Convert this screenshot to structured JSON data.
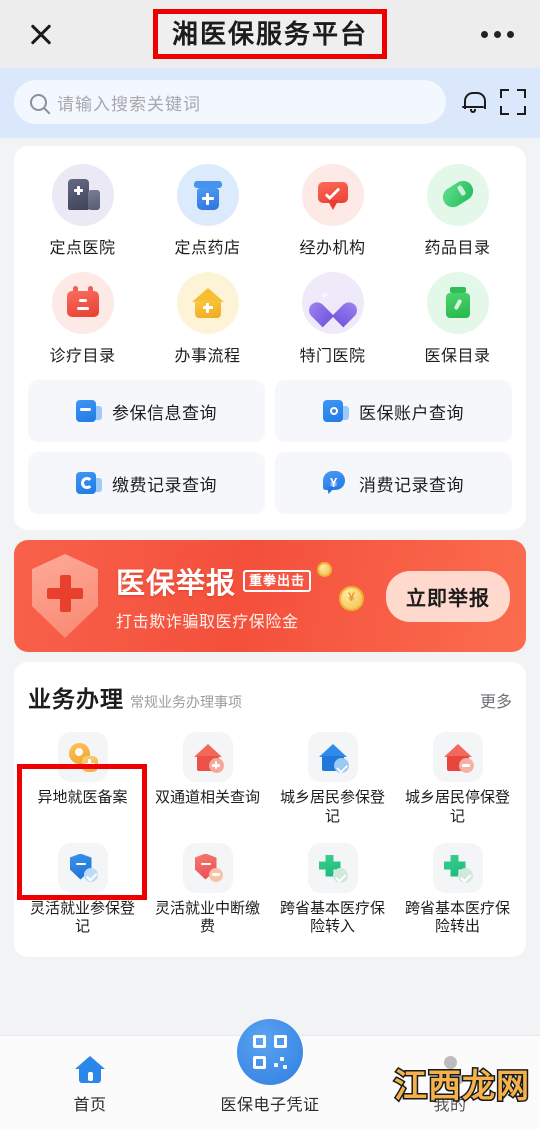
{
  "header": {
    "close_icon": "close-icon",
    "title": "湘医保服务平台",
    "more_icon": "more-dots-icon",
    "highlight_color": "#ef0000"
  },
  "search": {
    "icon": "search-icon",
    "placeholder": "请输入搜索关键词",
    "value": "",
    "bell_icon": "bell-icon",
    "scan_icon": "scan-icon"
  },
  "quick_icons": [
    {
      "label": "定点医院",
      "icon": "hospital-icon",
      "bg": "#ece9f7"
    },
    {
      "label": "定点药店",
      "icon": "pharmacy-icon",
      "bg": "#dcebfc"
    },
    {
      "label": "经办机构",
      "icon": "agency-badge-icon",
      "bg": "#fdeae7"
    },
    {
      "label": "药品目录",
      "icon": "capsule-icon",
      "bg": "#e4f8ea"
    },
    {
      "label": "诊疗目录",
      "icon": "treatment-calendar-icon",
      "bg": "#fdeae7"
    },
    {
      "label": "办事流程",
      "icon": "process-house-icon",
      "bg": "#fdf4d8"
    },
    {
      "label": "特门医院",
      "icon": "heart-icon",
      "bg": "#eeeafa"
    },
    {
      "label": "医保目录",
      "icon": "medicine-bottle-icon",
      "bg": "#e4f8ea"
    }
  ],
  "query_buttons": [
    {
      "label": "参保信息查询",
      "icon": "insurance-info-icon"
    },
    {
      "label": "医保账户查询",
      "icon": "account-wallet-icon"
    },
    {
      "label": "缴费记录查询",
      "icon": "payment-record-icon"
    },
    {
      "label": "消费记录查询",
      "icon": "consumption-record-icon"
    }
  ],
  "banner": {
    "title": "医保举报",
    "badge": "重拳出击",
    "subtitle": "打击欺诈骗取医疗保险金",
    "button": "立即举报",
    "shield_icon": "shield-cross-icon",
    "coin_icon": "coin-icon",
    "bg_color": "#f4503c"
  },
  "service_section": {
    "title": "业务办理",
    "subtitle": "常规业务办理事项",
    "more": "更多",
    "items": [
      {
        "label": "异地就医备案",
        "icon": "location-pin-plus-icon",
        "highlighted": true
      },
      {
        "label": "双通道相关查询",
        "icon": "house-red-icon"
      },
      {
        "label": "城乡居民参保登记",
        "icon": "house-blue-check-icon"
      },
      {
        "label": "城乡居民停保登记",
        "icon": "house-red-minus-icon"
      },
      {
        "label": "灵活就业参保登记",
        "icon": "shield-blue-check-icon"
      },
      {
        "label": "灵活就业中断缴费",
        "icon": "shield-red-minus-icon"
      },
      {
        "label": "跨省基本医疗保险转入",
        "icon": "cross-transfer-in-icon"
      },
      {
        "label": "跨省基本医疗保险转出",
        "icon": "cross-transfer-out-icon"
      }
    ]
  },
  "bottom_nav": {
    "items": [
      {
        "label": "首页",
        "icon": "home-icon",
        "active": true
      },
      {
        "label": "医保电子凭证",
        "icon": "qr-code-icon",
        "active": false
      },
      {
        "label": "我的",
        "icon": "person-icon",
        "active": false
      }
    ]
  },
  "watermark": {
    "text": "江西龙网"
  }
}
